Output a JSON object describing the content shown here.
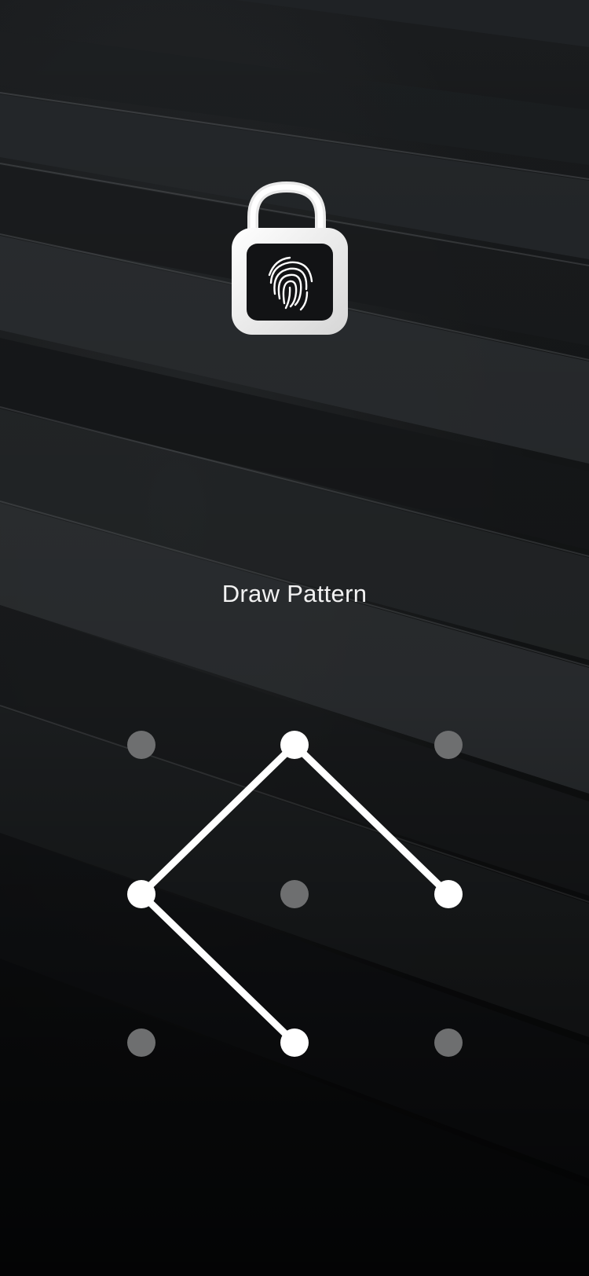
{
  "lock_screen": {
    "title": "Draw Pattern",
    "icon": "padlock-fingerprint-icon"
  },
  "pattern_grid": {
    "rows": 3,
    "columns": 3,
    "dots": [
      {
        "row": 1,
        "col": 1,
        "state": "inactive"
      },
      {
        "row": 1,
        "col": 2,
        "state": "active"
      },
      {
        "row": 1,
        "col": 3,
        "state": "inactive"
      },
      {
        "row": 2,
        "col": 1,
        "state": "active"
      },
      {
        "row": 2,
        "col": 2,
        "state": "inactive"
      },
      {
        "row": 2,
        "col": 3,
        "state": "active"
      },
      {
        "row": 3,
        "col": 1,
        "state": "inactive"
      },
      {
        "row": 3,
        "col": 2,
        "state": "active"
      },
      {
        "row": 3,
        "col": 3,
        "state": "inactive"
      }
    ],
    "drawn_sequence": [
      6,
      2,
      4,
      8
    ]
  },
  "colors": {
    "active_dot": "#ffffff",
    "inactive_dot": "#6e6f70",
    "pattern_line": "#ffffff",
    "title_text": "#f2f2f2"
  }
}
